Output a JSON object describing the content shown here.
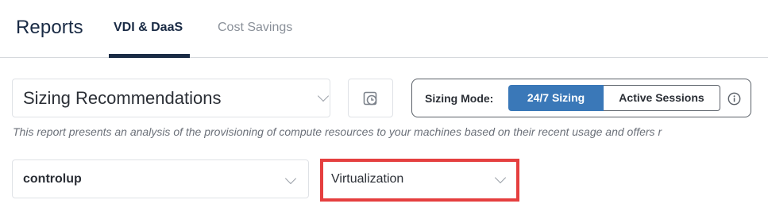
{
  "header": {
    "title": "Reports",
    "tabs": [
      {
        "label": "VDI & DaaS",
        "active": true
      },
      {
        "label": "Cost Savings",
        "active": false
      }
    ]
  },
  "report_select": {
    "value": "Sizing Recommendations",
    "icon": "chevron-down-icon"
  },
  "history_button": {
    "icon": "history-icon"
  },
  "sizing_mode": {
    "label": "Sizing Mode:",
    "options": [
      {
        "label": "24/7 Sizing",
        "active": true
      },
      {
        "label": "Active Sessions",
        "active": false
      }
    ],
    "info_icon": "info-icon"
  },
  "description": "This report presents an analysis of the provisioning of compute resources to your machines based on their recent usage and offers r",
  "filters": {
    "organization": "controlup",
    "virtualization": "Virtualization"
  },
  "colors": {
    "accent": "#3a78b8",
    "text_dark": "#1a2b45",
    "highlight": "#e53f3f"
  }
}
